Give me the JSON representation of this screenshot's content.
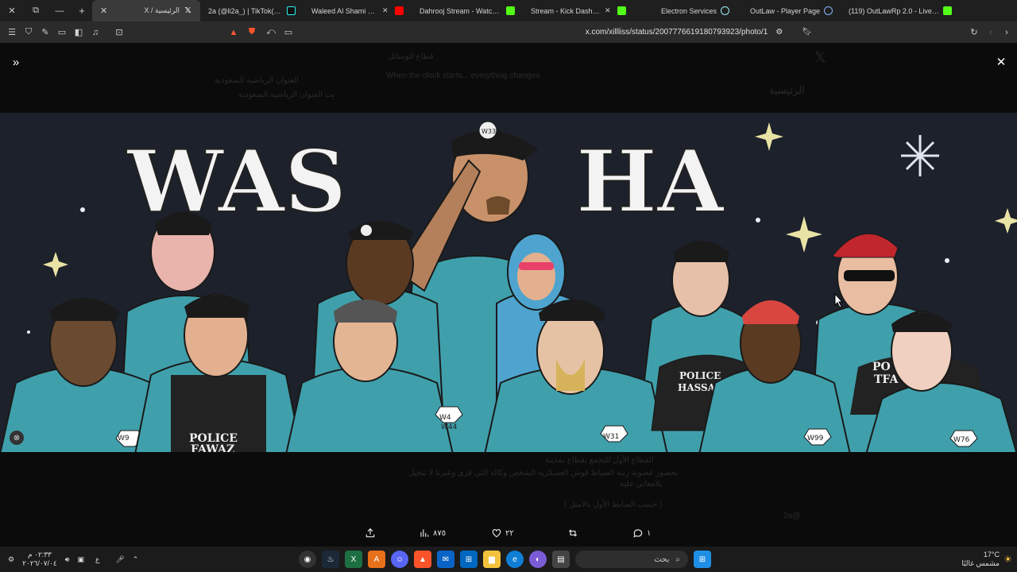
{
  "browser": {
    "tabs": [
      {
        "title": "X / الرئيسية",
        "favicon": "x-logo-icon",
        "color": "#ffffff",
        "active": true
      },
      {
        "title": "2a (@li2a_) | TikTok(11)",
        "favicon": "tiktok-icon",
        "color": "#25f4ee",
        "active": false
      },
      {
        "title": "Waleed Al Shami & Rashed",
        "favicon": "youtube-icon",
        "color": "#ff0000",
        "active": false
      },
      {
        "title": "Dahrooj Stream - Watch Live o",
        "favicon": "kick-icon",
        "color": "#53fc18",
        "active": false
      },
      {
        "title": "Stream - Kick Dashboard",
        "favicon": "kick-icon",
        "color": "#53fc18",
        "active": false
      },
      {
        "title": "Electron Services",
        "favicon": "electron-icon",
        "color": "#9feaf9",
        "active": false
      },
      {
        "title": "OutLaw - Player Page",
        "favicon": "globe-icon",
        "color": "#8ab4f8",
        "active": false
      },
      {
        "title": "(119) OutLawRp 2.0 - Live Com",
        "favicon": "kick-icon",
        "color": "#53fc18",
        "active": false
      }
    ],
    "url": "x.com/xillliss/status/2007776619180793923/photo/1"
  },
  "page": {
    "ghost_header": "قطاع الوسائل",
    "ghost_sub": "When the clock starts... everything changes",
    "ghost_home": "الرئيسية",
    "ghost_account": "العنوان الرياضية السعودية",
    "ghost_account2": "بث العنوان الرياضية السعودية",
    "ghost_body": "القطاع الأول للتجمع بقطاع بمدينة",
    "ghost_body2": "بحضور عضوية رتبة الضباط قوش العسكرية الشخص وكالة التي قرى وعبرنا لا تتخيل",
    "ghost_body3": "بلامعاني عليه",
    "ghost_body4": "( حسب الضابط الأول بالأمثل )",
    "ghost_handle": "@2a",
    "photo_title_left": "WAS",
    "photo_title_right": "HA",
    "patches": [
      "W33",
      "W9",
      "W4",
      "W44",
      "W31",
      "W99",
      "W76"
    ],
    "vest_labels": [
      [
        "POLICE",
        "FAWAZ"
      ],
      [
        "POLICE",
        "HASSAN"
      ],
      [
        "PO",
        "TFA"
      ]
    ]
  },
  "actions": {
    "views": "٨٧٥",
    "likes": "٢٢",
    "reposts": "",
    "replies": "١"
  },
  "taskbar": {
    "time": "٠٢:٣٣ م",
    "date": "٢٠٢٦/٠٧/٠٤",
    "lang": "ع",
    "search_placeholder": "بحث",
    "temp": "17°C",
    "weather": "مشمس غالبًا"
  }
}
